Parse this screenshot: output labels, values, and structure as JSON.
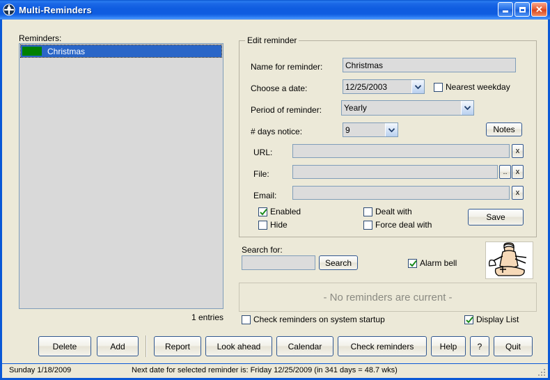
{
  "window": {
    "title": "Multi-Reminders",
    "icon": "app-cross-circle-icon",
    "controls": {
      "minimize": "minimize-icon",
      "maximize": "maximize-icon",
      "close": "close-icon"
    }
  },
  "list_panel": {
    "label": "Reminders:",
    "items": [
      {
        "name": "Christmas",
        "color": "#008000"
      }
    ],
    "count_text": "1 entries"
  },
  "edit_group": {
    "title": "Edit reminder",
    "fields": {
      "name_label": "Name for reminder:",
      "name_value": "Christmas",
      "date_label": "Choose a date:",
      "date_value": "12/25/2003",
      "nearest_weekday_label": "Nearest weekday",
      "nearest_weekday_checked": false,
      "period_label": "Period of reminder:",
      "period_value": "Yearly",
      "days_notice_label": "# days notice:",
      "days_notice_value": "9",
      "notes_label": "Notes",
      "url_label": "URL:",
      "url_value": "",
      "file_label": "File:",
      "file_value": "",
      "email_label": "Email:",
      "email_value": "",
      "browse_label": "..",
      "clear_label": "x"
    },
    "checkboxes": {
      "enabled_label": "Enabled",
      "enabled_checked": true,
      "hide_label": "Hide",
      "hide_checked": false,
      "dealt_with_label": "Dealt with",
      "dealt_with_checked": false,
      "force_deal_with_label": "Force deal with",
      "force_deal_with_checked": false
    },
    "save_label": "Save"
  },
  "search": {
    "label": "Search for:",
    "value": "",
    "button_label": "Search",
    "alarm_bell_label": "Alarm bell",
    "alarm_bell_checked": true,
    "alarm_image": "alarm-bell-illustration"
  },
  "status_panel": {
    "message": "- No reminders are current -"
  },
  "options": {
    "startup_label": "Check reminders on system startup",
    "startup_checked": false,
    "display_list_label": "Display List",
    "display_list_checked": true
  },
  "toolbar": {
    "buttons": [
      {
        "label": "Delete",
        "name": "delete-button"
      },
      {
        "label": "Add",
        "name": "add-button"
      },
      {
        "label": "Report",
        "name": "report-button"
      },
      {
        "label": "Look ahead",
        "name": "look-ahead-button"
      },
      {
        "label": "Calendar",
        "name": "calendar-button"
      },
      {
        "label": "Check reminders",
        "name": "check-reminders-button"
      },
      {
        "label": "Help",
        "name": "help-button"
      },
      {
        "label": "?",
        "name": "about-button"
      },
      {
        "label": "Quit",
        "name": "quit-button"
      }
    ]
  },
  "statusbar": {
    "date": "Sunday  1/18/2009",
    "next_date": "Next date for selected reminder is: Friday 12/25/2009 (in 341 days = 48.7 wks)"
  },
  "colors": {
    "titlebar_blue": "#0f5ce0",
    "window_bg": "#ece9d8",
    "field_bg": "#dcdcdc",
    "field_border": "#7f9db9",
    "selection_blue": "#2a66c8",
    "swatch_green": "#008000",
    "check_green": "#1a8a1a",
    "status_text_gray": "#8a8a82"
  }
}
